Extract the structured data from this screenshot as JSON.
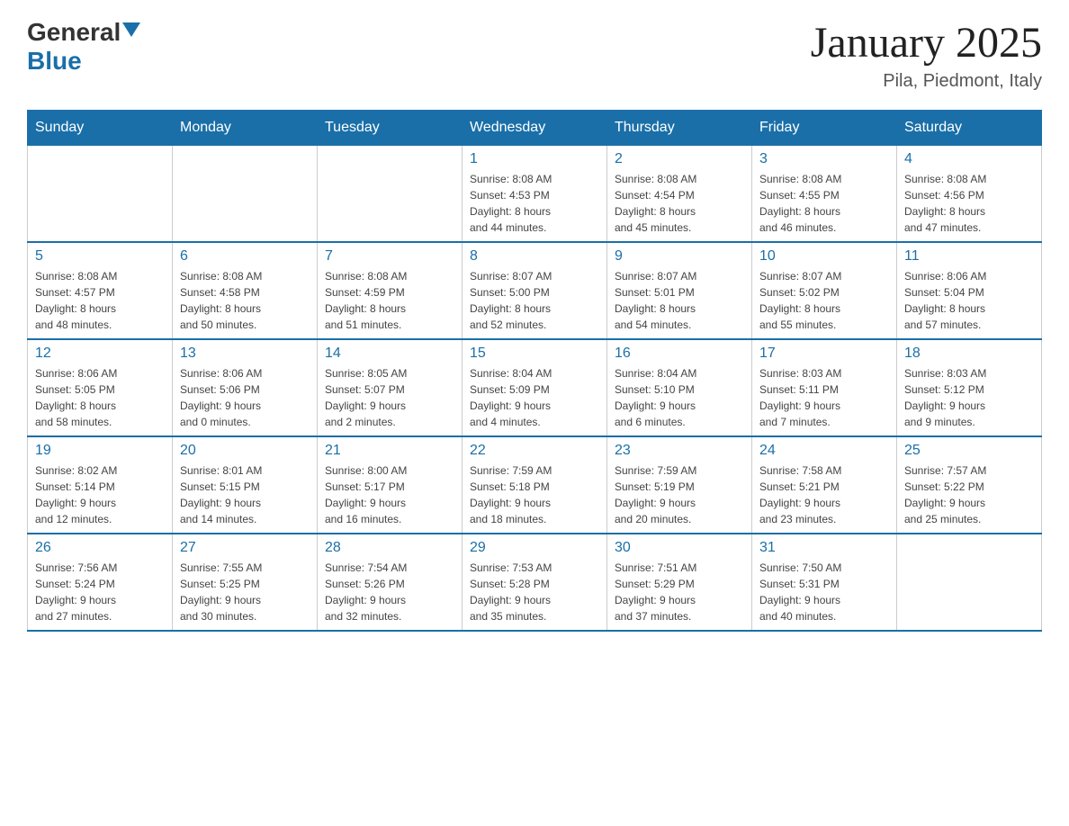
{
  "header": {
    "logo_general": "General",
    "logo_blue": "Blue",
    "month_title": "January 2025",
    "location": "Pila, Piedmont, Italy"
  },
  "days_of_week": [
    "Sunday",
    "Monday",
    "Tuesday",
    "Wednesday",
    "Thursday",
    "Friday",
    "Saturday"
  ],
  "weeks": [
    [
      {
        "day": "",
        "info": ""
      },
      {
        "day": "",
        "info": ""
      },
      {
        "day": "",
        "info": ""
      },
      {
        "day": "1",
        "info": "Sunrise: 8:08 AM\nSunset: 4:53 PM\nDaylight: 8 hours\nand 44 minutes."
      },
      {
        "day": "2",
        "info": "Sunrise: 8:08 AM\nSunset: 4:54 PM\nDaylight: 8 hours\nand 45 minutes."
      },
      {
        "day": "3",
        "info": "Sunrise: 8:08 AM\nSunset: 4:55 PM\nDaylight: 8 hours\nand 46 minutes."
      },
      {
        "day": "4",
        "info": "Sunrise: 8:08 AM\nSunset: 4:56 PM\nDaylight: 8 hours\nand 47 minutes."
      }
    ],
    [
      {
        "day": "5",
        "info": "Sunrise: 8:08 AM\nSunset: 4:57 PM\nDaylight: 8 hours\nand 48 minutes."
      },
      {
        "day": "6",
        "info": "Sunrise: 8:08 AM\nSunset: 4:58 PM\nDaylight: 8 hours\nand 50 minutes."
      },
      {
        "day": "7",
        "info": "Sunrise: 8:08 AM\nSunset: 4:59 PM\nDaylight: 8 hours\nand 51 minutes."
      },
      {
        "day": "8",
        "info": "Sunrise: 8:07 AM\nSunset: 5:00 PM\nDaylight: 8 hours\nand 52 minutes."
      },
      {
        "day": "9",
        "info": "Sunrise: 8:07 AM\nSunset: 5:01 PM\nDaylight: 8 hours\nand 54 minutes."
      },
      {
        "day": "10",
        "info": "Sunrise: 8:07 AM\nSunset: 5:02 PM\nDaylight: 8 hours\nand 55 minutes."
      },
      {
        "day": "11",
        "info": "Sunrise: 8:06 AM\nSunset: 5:04 PM\nDaylight: 8 hours\nand 57 minutes."
      }
    ],
    [
      {
        "day": "12",
        "info": "Sunrise: 8:06 AM\nSunset: 5:05 PM\nDaylight: 8 hours\nand 58 minutes."
      },
      {
        "day": "13",
        "info": "Sunrise: 8:06 AM\nSunset: 5:06 PM\nDaylight: 9 hours\nand 0 minutes."
      },
      {
        "day": "14",
        "info": "Sunrise: 8:05 AM\nSunset: 5:07 PM\nDaylight: 9 hours\nand 2 minutes."
      },
      {
        "day": "15",
        "info": "Sunrise: 8:04 AM\nSunset: 5:09 PM\nDaylight: 9 hours\nand 4 minutes."
      },
      {
        "day": "16",
        "info": "Sunrise: 8:04 AM\nSunset: 5:10 PM\nDaylight: 9 hours\nand 6 minutes."
      },
      {
        "day": "17",
        "info": "Sunrise: 8:03 AM\nSunset: 5:11 PM\nDaylight: 9 hours\nand 7 minutes."
      },
      {
        "day": "18",
        "info": "Sunrise: 8:03 AM\nSunset: 5:12 PM\nDaylight: 9 hours\nand 9 minutes."
      }
    ],
    [
      {
        "day": "19",
        "info": "Sunrise: 8:02 AM\nSunset: 5:14 PM\nDaylight: 9 hours\nand 12 minutes."
      },
      {
        "day": "20",
        "info": "Sunrise: 8:01 AM\nSunset: 5:15 PM\nDaylight: 9 hours\nand 14 minutes."
      },
      {
        "day": "21",
        "info": "Sunrise: 8:00 AM\nSunset: 5:17 PM\nDaylight: 9 hours\nand 16 minutes."
      },
      {
        "day": "22",
        "info": "Sunrise: 7:59 AM\nSunset: 5:18 PM\nDaylight: 9 hours\nand 18 minutes."
      },
      {
        "day": "23",
        "info": "Sunrise: 7:59 AM\nSunset: 5:19 PM\nDaylight: 9 hours\nand 20 minutes."
      },
      {
        "day": "24",
        "info": "Sunrise: 7:58 AM\nSunset: 5:21 PM\nDaylight: 9 hours\nand 23 minutes."
      },
      {
        "day": "25",
        "info": "Sunrise: 7:57 AM\nSunset: 5:22 PM\nDaylight: 9 hours\nand 25 minutes."
      }
    ],
    [
      {
        "day": "26",
        "info": "Sunrise: 7:56 AM\nSunset: 5:24 PM\nDaylight: 9 hours\nand 27 minutes."
      },
      {
        "day": "27",
        "info": "Sunrise: 7:55 AM\nSunset: 5:25 PM\nDaylight: 9 hours\nand 30 minutes."
      },
      {
        "day": "28",
        "info": "Sunrise: 7:54 AM\nSunset: 5:26 PM\nDaylight: 9 hours\nand 32 minutes."
      },
      {
        "day": "29",
        "info": "Sunrise: 7:53 AM\nSunset: 5:28 PM\nDaylight: 9 hours\nand 35 minutes."
      },
      {
        "day": "30",
        "info": "Sunrise: 7:51 AM\nSunset: 5:29 PM\nDaylight: 9 hours\nand 37 minutes."
      },
      {
        "day": "31",
        "info": "Sunrise: 7:50 AM\nSunset: 5:31 PM\nDaylight: 9 hours\nand 40 minutes."
      },
      {
        "day": "",
        "info": ""
      }
    ]
  ]
}
